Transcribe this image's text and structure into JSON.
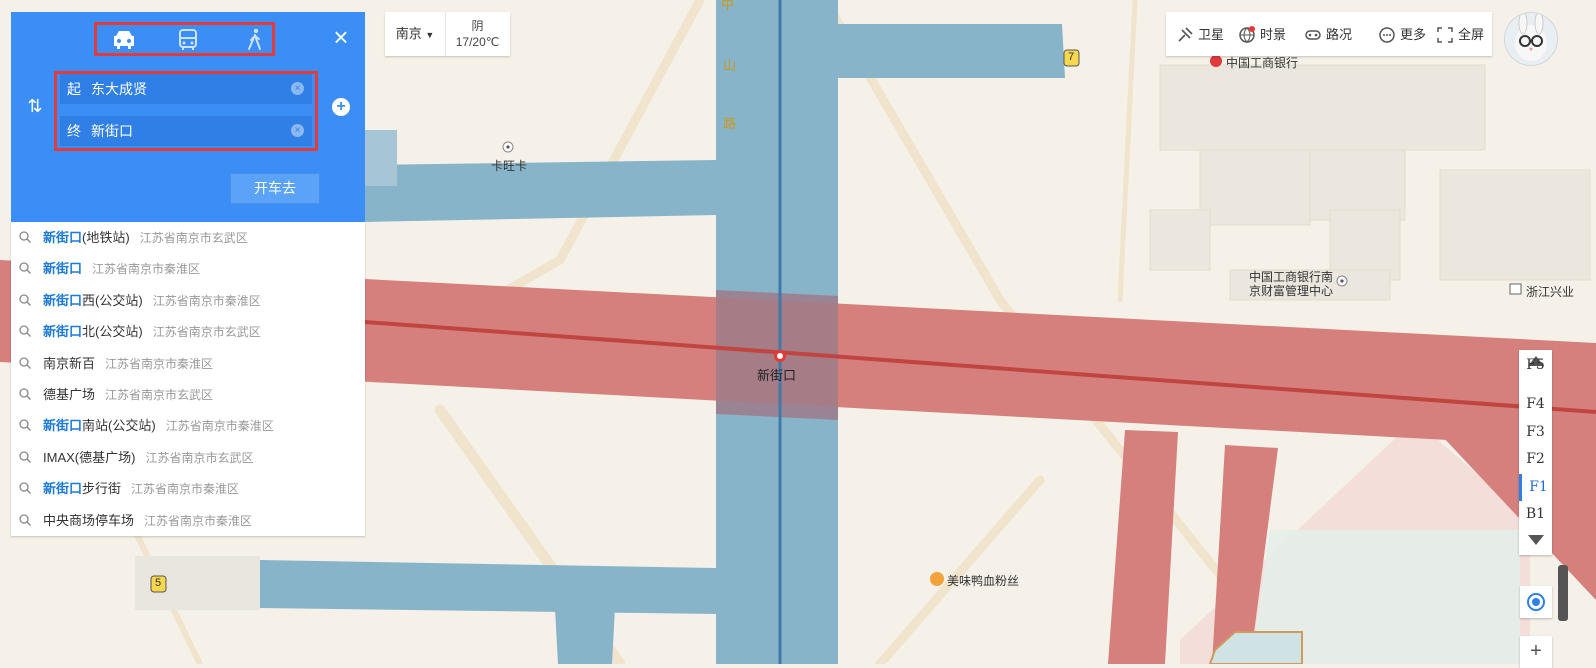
{
  "panel": {
    "modes": [
      {
        "name": "car-icon"
      },
      {
        "name": "bus-icon"
      },
      {
        "name": "walk-icon"
      }
    ],
    "start_prefix": "起",
    "start_value": "东大成贤",
    "end_prefix": "终",
    "end_value": "新街口",
    "go_label": "开车去"
  },
  "suggestions": [
    {
      "hl": "新街口",
      "rest": "(地铁站)",
      "addr": "江苏省南京市玄武区"
    },
    {
      "hl": "新街口",
      "rest": "",
      "addr": "江苏省南京市秦淮区"
    },
    {
      "hl": "新街口",
      "rest": "西(公交站)",
      "addr": "江苏省南京市秦淮区"
    },
    {
      "hl": "新街口",
      "rest": "北(公交站)",
      "addr": "江苏省南京市玄武区"
    },
    {
      "hl": "",
      "rest": "南京新百",
      "addr": "江苏省南京市秦淮区"
    },
    {
      "hl": "",
      "rest": "德基广场",
      "addr": "江苏省南京市玄武区"
    },
    {
      "hl": "新街口",
      "rest": "南站(公交站)",
      "addr": "江苏省南京市秦淮区"
    },
    {
      "hl": "",
      "rest": "IMAX(德基广场)",
      "addr": "江苏省南京市玄武区"
    },
    {
      "hl": "新街口",
      "rest": "步行街",
      "addr": "江苏省南京市秦淮区"
    },
    {
      "hl": "",
      "rest": "中央商场停车场",
      "addr": "江苏省南京市秦淮区"
    }
  ],
  "weather": {
    "city": "南京",
    "condition": "阴",
    "temp": "17/20℃"
  },
  "toolbar": {
    "satellite": "卫星",
    "timelapse": "时景",
    "traffic": "路况",
    "more": "更多",
    "fullscreen": "全屏"
  },
  "floors": {
    "partial": "F5",
    "items": [
      "F4",
      "F3",
      "F2",
      "F1",
      "B1"
    ],
    "active": "F1"
  },
  "map_labels": {
    "road_zhong": "中",
    "road_shan": "山",
    "road_lu": "路",
    "station": "新街口",
    "kawangka": "卡旺卡",
    "icbc": "中国工商银行",
    "icbc_wealth_1": "中国工商银行南",
    "icbc_wealth_2": "京财富管理中心",
    "zheshang": "浙江兴业",
    "restaurant": "美味鸭血粉丝",
    "exit7": "7",
    "exit5": "5"
  },
  "zoom_in_label": "+"
}
